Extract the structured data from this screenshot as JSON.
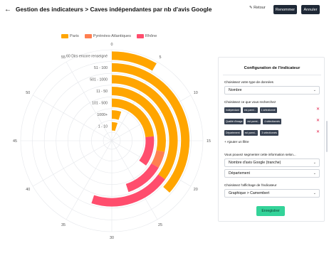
{
  "header": {
    "title": "Gestion des indicateurs > Caves indépendantes par nb d'avis Google",
    "back_label": "Retour",
    "rename_label": "Renommer",
    "cancel_label": "Annuler"
  },
  "chart_data": {
    "type": "polar-bar",
    "categories": [
      "60 Dirs encore renseigné",
      "51 - 100",
      "501 - 1000",
      "11 - 50",
      "101 - 500",
      "1000+",
      "1 - 10"
    ],
    "series": [
      {
        "name": "Paris",
        "color": "#ffa500",
        "values": [
          5,
          22,
          21,
          17,
          14,
          3,
          3
        ]
      },
      {
        "name": "Pyrénées-Atlantiques",
        "color": "#ff7f50",
        "values": [
          0,
          0,
          0,
          3,
          0,
          0,
          0
        ]
      },
      {
        "name": "Rhône",
        "color": "#ff4d6d",
        "values": [
          0,
          0,
          12,
          7,
          7,
          0,
          0
        ]
      }
    ],
    "angular_ticks": [
      "0",
      "5",
      "10",
      "15",
      "20",
      "25",
      "30",
      "35",
      "40",
      "45",
      "50",
      "55"
    ],
    "angular_max": 60,
    "grid": true,
    "legend_position": "top"
  },
  "side": {
    "title": "Configuration de l'indicateur",
    "data_type_label": "Choisissez votre type de données",
    "data_type_value": "Nombre",
    "search_label": "Choisissez ce que vous recherchez",
    "filters": [
      {
        "chips": [
          "Indépendant",
          "est parmi...",
          "1 sélectionné"
        ]
      },
      {
        "chips": [
          "Qualité d'image",
          "est parmi...",
          "4 sélectionnés"
        ]
      },
      {
        "chips": [
          "Département",
          "est parmi...",
          "3 sélectionnés"
        ]
      }
    ],
    "add_filter_label": "+  Ajouter un filtre",
    "segment_label": "Vous pouvez segmenter cette information selon...",
    "segment_1": "Nombre d'avis Google (tranche)",
    "segment_2": "Département",
    "display_label": "Choisissez l'affichage de l'indicateur",
    "display_value": "Graphique > Camembert",
    "save_label": "Enregistrer"
  }
}
